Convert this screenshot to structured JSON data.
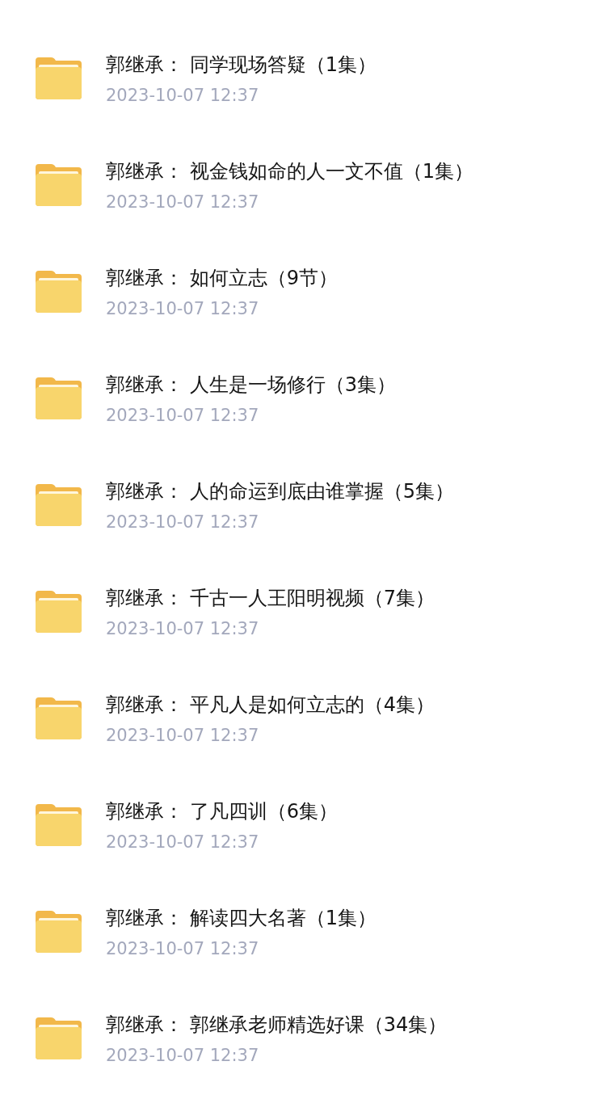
{
  "folders": [
    {
      "name": "郭继承： 同学现场答疑（1集）",
      "date": "2023-10-07 12:37"
    },
    {
      "name": "郭继承： 视金钱如命的人一文不值（1集）",
      "date": "2023-10-07 12:37"
    },
    {
      "name": "郭继承： 如何立志（9节）",
      "date": "2023-10-07 12:37"
    },
    {
      "name": "郭继承： 人生是一场修行（3集）",
      "date": "2023-10-07 12:37"
    },
    {
      "name": "郭继承： 人的命运到底由谁掌握（5集）",
      "date": "2023-10-07 12:37"
    },
    {
      "name": "郭继承： 千古一人王阳明视频（7集）",
      "date": "2023-10-07 12:37"
    },
    {
      "name": "郭继承： 平凡人是如何立志的（4集）",
      "date": "2023-10-07 12:37"
    },
    {
      "name": "郭继承： 了凡四训（6集）",
      "date": "2023-10-07 12:37"
    },
    {
      "name": "郭继承： 解读四大名著（1集）",
      "date": "2023-10-07 12:37"
    },
    {
      "name": "郭继承： 郭继承老师精选好课（34集）",
      "date": "2023-10-07 12:37"
    }
  ]
}
